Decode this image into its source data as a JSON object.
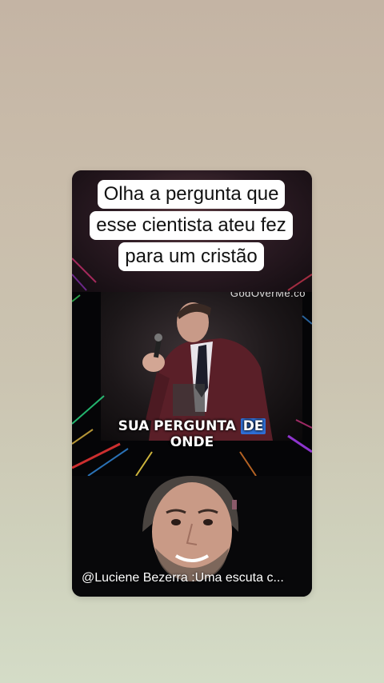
{
  "post": {
    "caption_lines": [
      "Olha a pergunta que",
      "esse cientista ateu fez",
      "para um cristão"
    ],
    "watermark": "GodOverMe.co",
    "subtitle": {
      "part1": "SUA PERGUNTA",
      "highlight": "DE",
      "line2": "ONDE"
    },
    "footer": "@Luciene Bezerra :Uma escuta c..."
  },
  "colors": {
    "background_top": "#c4b4a4",
    "background_bottom": "#d4dcc7",
    "subtitle_highlight": "#2f6fd6"
  }
}
